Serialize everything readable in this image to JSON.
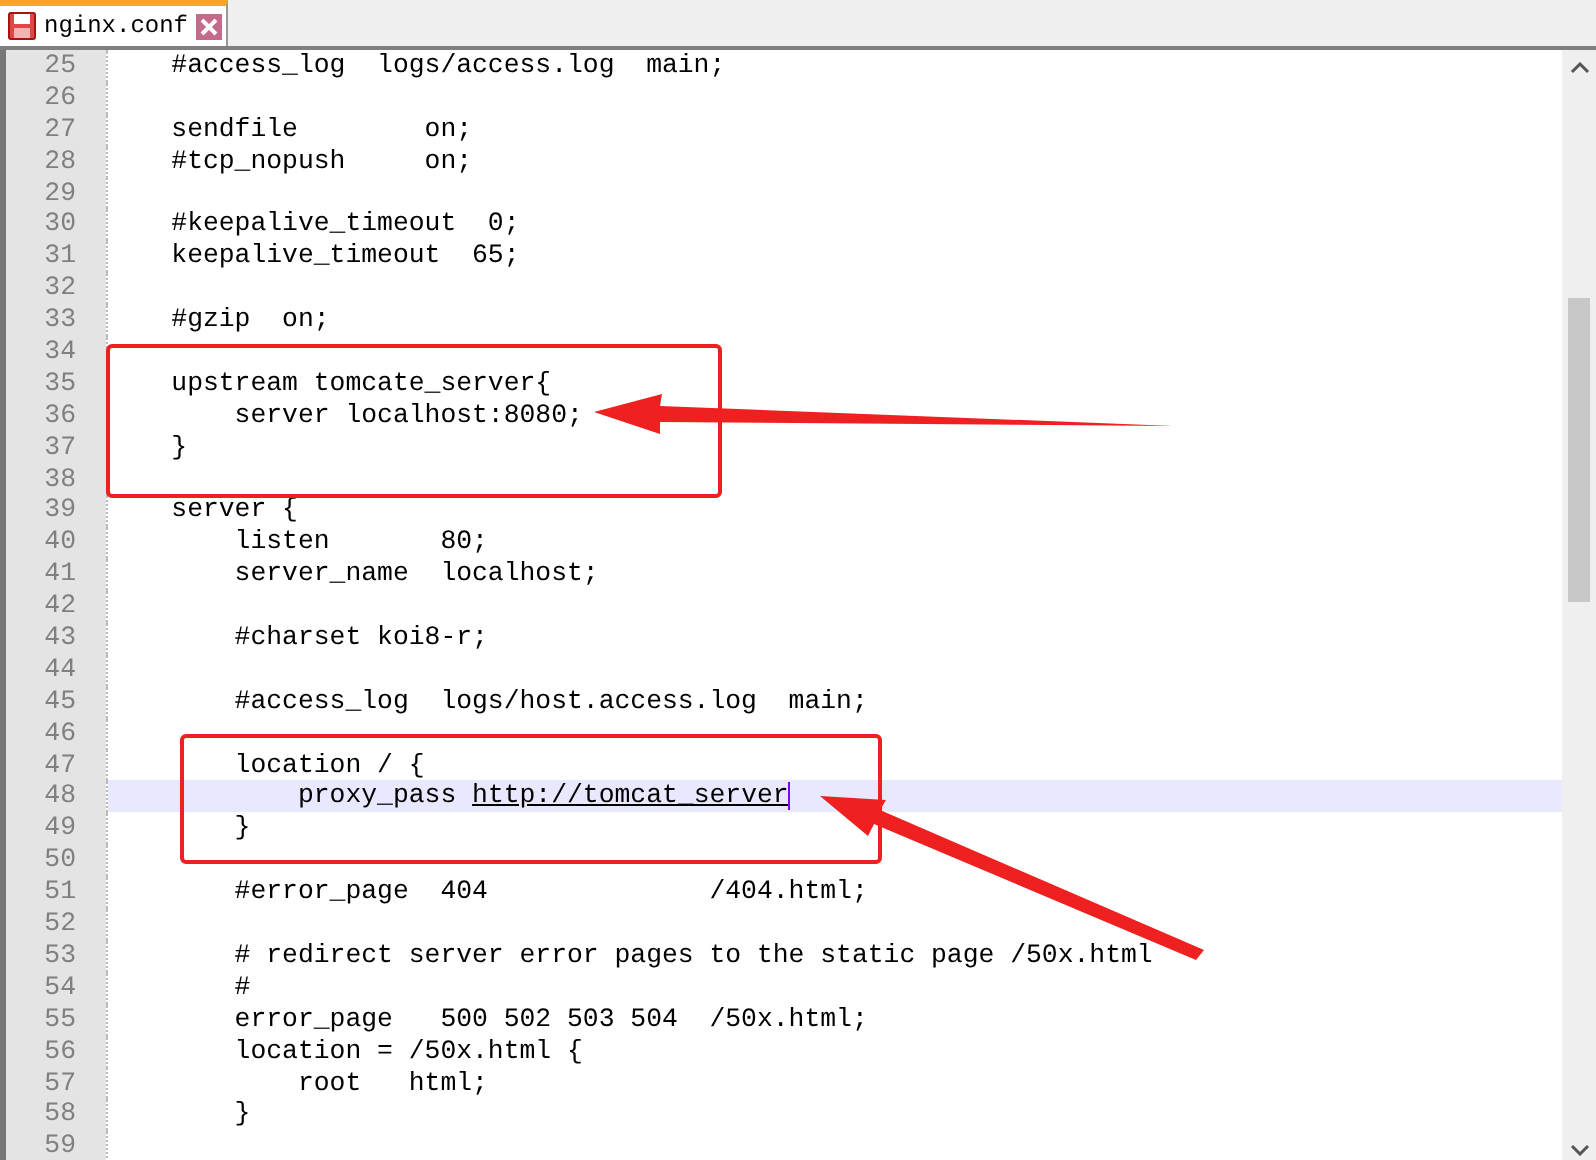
{
  "tabs": [
    {
      "label": "nginx.conf",
      "selected": true,
      "modified": false
    }
  ],
  "lines": [
    {
      "number": "25",
      "text": "    #access_log  logs/access.log  main;",
      "selected": false
    },
    {
      "number": "26",
      "selected": false
    },
    {
      "number": "27",
      "text": "    sendfile        on;",
      "selected": false
    },
    {
      "number": "28",
      "text": "    #tcp_nopush     on;",
      "selected": false
    },
    {
      "number": "29",
      "selected": false
    },
    {
      "number": "30",
      "text": "    #keepalive_timeout  0;",
      "selected": false
    },
    {
      "number": "31",
      "text": "    keepalive_timeout  65;",
      "selected": false
    },
    {
      "number": "32",
      "selected": false
    },
    {
      "number": "33",
      "text": "    #gzip  on;",
      "selected": false
    },
    {
      "number": "34",
      "selected": false
    },
    {
      "number": "35",
      "text": "    upstream tomcate_server{",
      "selected": false
    },
    {
      "number": "36",
      "text": "        server localhost:8080;",
      "selected": false
    },
    {
      "number": "37",
      "text": "    }",
      "selected": false
    },
    {
      "number": "38",
      "selected": false
    },
    {
      "number": "39",
      "text": "    server {",
      "selected": false
    },
    {
      "number": "40",
      "text": "        listen       80;",
      "selected": false
    },
    {
      "number": "41",
      "text": "        server_name  localhost;",
      "selected": false
    },
    {
      "number": "42",
      "selected": false
    },
    {
      "number": "43",
      "text": "        #charset koi8-r;",
      "selected": false
    },
    {
      "number": "44",
      "selected": false
    },
    {
      "number": "45",
      "text": "        #access_log  logs/host.access.log  main;",
      "selected": false
    },
    {
      "number": "46",
      "selected": false
    },
    {
      "number": "47",
      "text": "        location / {",
      "selected": false
    },
    {
      "number": "48",
      "text": "            proxy_pass ",
      "link": "http://tomcat_server",
      "selected": true
    },
    {
      "number": "49",
      "text": "        }",
      "selected": false
    },
    {
      "number": "50",
      "selected": false
    },
    {
      "number": "51",
      "text": "        #error_page  404              /404.html;",
      "selected": false
    },
    {
      "number": "52",
      "selected": false
    },
    {
      "number": "53",
      "text": "        # redirect server error pages to the static page /50x.html",
      "selected": false
    },
    {
      "number": "54",
      "text": "        #",
      "selected": false
    },
    {
      "number": "55",
      "text": "        error_page   500 502 503 504  /50x.html;",
      "selected": false
    },
    {
      "number": "56",
      "text": "        location = /50x.html {",
      "selected": false
    },
    {
      "number": "57",
      "text": "            root   html;",
      "selected": false
    },
    {
      "number": "58",
      "text": "        }",
      "selected": false
    },
    {
      "number": "59",
      "selected": false
    }
  ]
}
